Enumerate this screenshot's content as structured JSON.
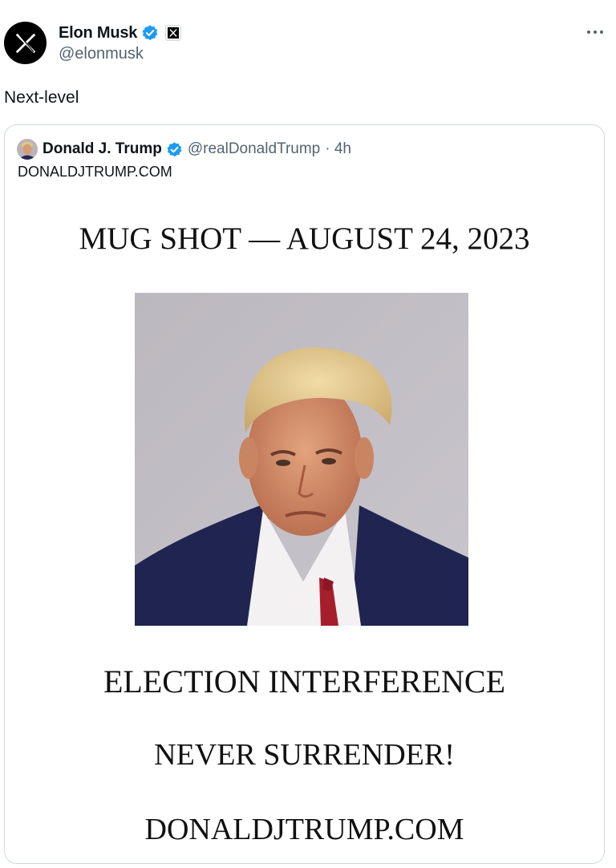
{
  "tweet": {
    "author": {
      "name": "Elon Musk",
      "handle": "@elonmusk"
    },
    "text": "Next-level",
    "more_icon": "more-horizontal-icon"
  },
  "quoted_tweet": {
    "author": {
      "name": "Donald J. Trump",
      "handle": "@realDonaldTrump",
      "time": "· 4h"
    },
    "text": "DONALDJTRUMP.COM",
    "image": {
      "headline": "MUG SHOT — AUGUST 24, 2023",
      "line1": "ELECTION INTERFERENCE",
      "line2": "NEVER SURRENDER!",
      "line3": "DONALDJTRUMP.COM"
    }
  },
  "colors": {
    "verified": "#1d9bf0",
    "secondary_text": "#536471",
    "border": "#cfd9de"
  }
}
